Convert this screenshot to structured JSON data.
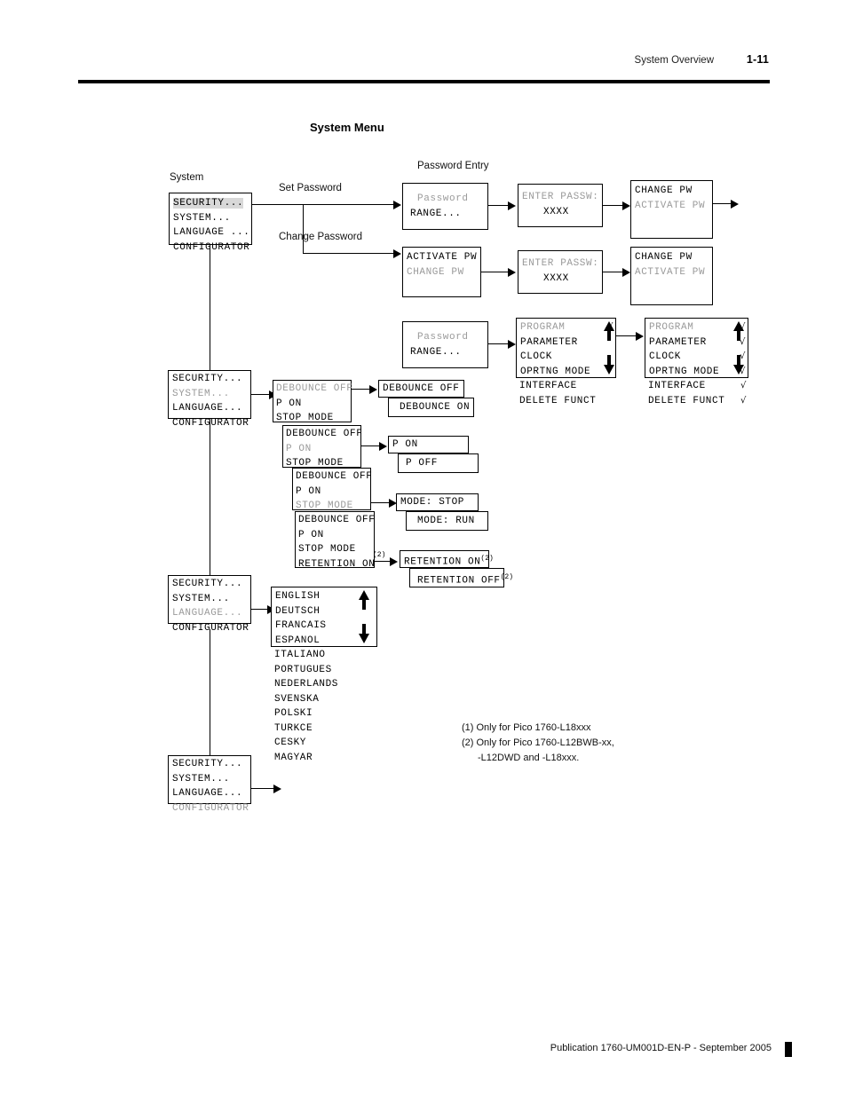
{
  "header": {
    "title": "System Overview",
    "page": "1-11"
  },
  "section_heading": "System Menu",
  "labels": {
    "system": "System",
    "password_entry": "Password Entry",
    "set_password": "Set Password",
    "change_password": "Change Password"
  },
  "system_menu": {
    "items": [
      "SECURITY...",
      "SYSTEM...",
      "LANGUAGE ...",
      "CONFIGURATOR"
    ],
    "items_plain": [
      "SECURITY...",
      "SYSTEM...",
      "LANGUAGE...",
      "CONFIGURATOR"
    ]
  },
  "screens": {
    "password_range": {
      "l1": "Password",
      "l2": "RANGE..."
    },
    "enter_passw": {
      "l1": "ENTER PASSW:",
      "l2": "XXXX"
    },
    "change_pw": {
      "l1": "CHANGE PW",
      "l2": "ACTIVATE PW"
    },
    "activate_pw": {
      "l1": "ACTIVATE PW",
      "l2": "CHANGE PW"
    },
    "debounce": {
      "l1": "DEBOUNCE OFF",
      "l2": "P ON",
      "l3": "STOP MODE",
      "l4": "RETENTION ON"
    },
    "debounce_off": "DEBOUNCE OFF",
    "debounce_on": "DEBOUNCE ON",
    "p_on": "P ON",
    "p_off": "P OFF",
    "mode_stop": "MODE: STOP",
    "mode_run": "MODE: RUN",
    "retention_on": "RETENTION ON",
    "retention_off": "RETENTION OFF",
    "footnote_mark_2": "(2)"
  },
  "configurator": {
    "boxed": [
      "PROGRAM",
      "PARAMETER",
      "CLOCK",
      "OPRTNG MODE"
    ],
    "below": [
      "INTERFACE",
      "DELETE FUNCT"
    ],
    "check": "√",
    "left_checks": [
      true,
      false,
      false,
      false,
      false,
      false
    ],
    "right_checks": [
      true,
      true,
      true,
      true,
      true,
      true
    ]
  },
  "languages": {
    "boxed": [
      "ENGLISH",
      "DEUTSCH",
      "FRANCAIS",
      "ESPANOL"
    ],
    "below": [
      "ITALIANO",
      "PORTUGUES",
      "NEDERLANDS",
      "SVENSKA",
      "POLSKI",
      "TURKCE",
      "CESKY",
      "MAGYAR"
    ]
  },
  "footnotes": [
    "(1) Only for Pico 1760-L18xxx",
    "(2) Only for Pico 1760-L12BWB-xx,",
    "-L12DWD and -L18xxx."
  ],
  "footer": {
    "text": "Publication 1760-UM001D-EN-P - September 2005"
  }
}
